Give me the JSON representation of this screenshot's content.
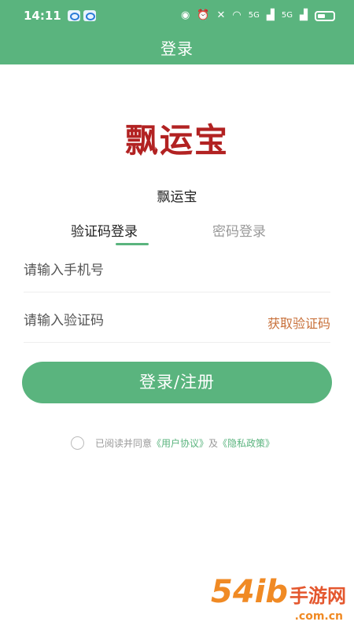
{
  "status_bar": {
    "time": "14:11",
    "icons": [
      "eye-icon",
      "alarm-icon",
      "mute-icon",
      "wifi-icon",
      "signal-5g-icon",
      "signal-5g-icon",
      "battery-icon"
    ],
    "network_labels": [
      "5G",
      "5G"
    ]
  },
  "header": {
    "title": "登录"
  },
  "app": {
    "logo_text": "飘运宝",
    "name": "飘运宝"
  },
  "tabs": [
    {
      "label": "验证码登录",
      "active": true
    },
    {
      "label": "密码登录",
      "active": false
    }
  ],
  "form": {
    "phone_placeholder": "请输入手机号",
    "code_placeholder": "请输入验证码",
    "get_code_label": "获取验证码",
    "submit_label": "登录/注册"
  },
  "agreement": {
    "prefix": "已阅读并同意",
    "user_agreement": "《用户协议》",
    "conjunction": "及",
    "privacy_policy": "《隐私政策》",
    "checked": false
  },
  "watermark": {
    "main": "54ib",
    "cn": "手游网",
    "sub": ".com.cn"
  },
  "colors": {
    "primary": "#5ab47e",
    "accent": "#c8703a",
    "logo": "#b22222"
  }
}
